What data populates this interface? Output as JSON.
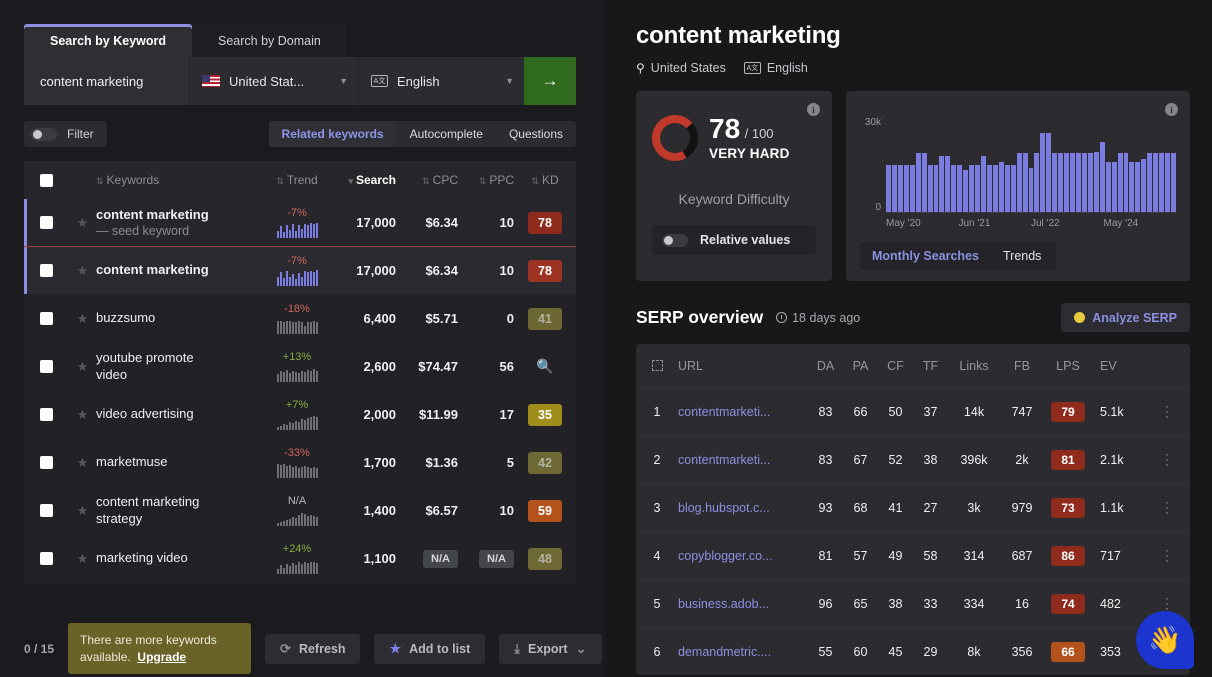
{
  "search_panel": {
    "tabs": [
      {
        "label": "Search by Keyword",
        "active": true
      },
      {
        "label": "Search by Domain",
        "active": false
      }
    ],
    "keyword_value": "content marketing",
    "keyword_placeholder": "Enter keyword",
    "country": "United Stat...",
    "language": "English",
    "go_label": "→",
    "filter_label": "Filter",
    "segments": [
      {
        "label": "Related keywords",
        "active": true
      },
      {
        "label": "Autocomplete",
        "active": false
      },
      {
        "label": "Questions",
        "active": false
      }
    ]
  },
  "keyword_table": {
    "columns": [
      "Keywords",
      "Trend",
      "Search",
      "CPC",
      "PPC",
      "KD"
    ],
    "sorted_by": "Search",
    "rows": [
      {
        "keyword": "content marketing",
        "sub": "— seed keyword",
        "trend": "-7%",
        "trend_dir": "down",
        "search": "17,000",
        "cpc": "$6.34",
        "ppc": "10",
        "kd": "78",
        "kd_color": "#8f2b1d",
        "kd_text": "#ffffff",
        "state": "seed",
        "spark_color": "blue",
        "spark": [
          7,
          12,
          6,
          13,
          8,
          14,
          7,
          13,
          9,
          14,
          13,
          15,
          14,
          15
        ]
      },
      {
        "keyword": "content marketing",
        "sub": "",
        "trend": "-7%",
        "trend_dir": "down",
        "search": "17,000",
        "cpc": "$6.34",
        "ppc": "10",
        "kd": "78",
        "kd_color": "#9c3323",
        "kd_text": "#ffffff",
        "state": "selected",
        "spark_color": "blue",
        "spark": [
          9,
          14,
          8,
          15,
          9,
          12,
          7,
          13,
          9,
          15,
          14,
          15,
          14,
          16
        ]
      },
      {
        "keyword": "buzzsumo",
        "sub": "",
        "trend": "-18%",
        "trend_dir": "down",
        "search": "6,400",
        "cpc": "$5.71",
        "ppc": "0",
        "kd": "41",
        "kd_color": "#6d6733",
        "kd_text": "#b3b0a0",
        "state": "",
        "spark_color": "gray",
        "spark": [
          13,
          13,
          12,
          13,
          13,
          12,
          12,
          13,
          12,
          8,
          12,
          12,
          13,
          12
        ]
      },
      {
        "keyword": "youtube promote",
        "sub2": "video",
        "trend": "+13%",
        "trend_dir": "up",
        "search": "2,600",
        "cpc": "$74.47",
        "ppc": "56",
        "kd": "",
        "kd_icon": "search-icon",
        "kd_color": "",
        "kd_text": "",
        "state": "",
        "spark_color": "gray",
        "spark": [
          8,
          11,
          10,
          12,
          9,
          11,
          10,
          9,
          11,
          10,
          12,
          11,
          13,
          11
        ]
      },
      {
        "keyword": "video advertising",
        "sub": "",
        "trend": "+7%",
        "trend_dir": "up",
        "search": "2,000",
        "cpc": "$11.99",
        "ppc": "17",
        "kd": "35",
        "kd_color": "#a08d1c",
        "kd_text": "#ffffff",
        "state": "",
        "spark_color": "gray",
        "spark": [
          3,
          4,
          6,
          5,
          8,
          7,
          9,
          8,
          11,
          10,
          12,
          13,
          14,
          13
        ]
      },
      {
        "keyword": "marketmuse",
        "sub": "",
        "trend": "-33%",
        "trend_dir": "down",
        "search": "1,700",
        "cpc": "$1.36",
        "ppc": "5",
        "kd": "42",
        "kd_color": "#6e6835",
        "kd_text": "#b4b1a1",
        "state": "",
        "spark_color": "gray",
        "spark": [
          14,
          13,
          14,
          12,
          13,
          11,
          12,
          10,
          11,
          12,
          11,
          10,
          11,
          10
        ]
      },
      {
        "keyword": "content marketing",
        "sub2": "strategy",
        "trend": "N/A",
        "trend_dir": "na",
        "search": "1,400",
        "cpc": "$6.57",
        "ppc": "10",
        "kd": "59",
        "kd_color": "#b4521c",
        "kd_text": "#ffffff",
        "state": "",
        "spark_color": "gray",
        "spark": [
          3,
          4,
          5,
          6,
          7,
          9,
          8,
          11,
          13,
          12,
          10,
          11,
          10,
          9
        ]
      },
      {
        "keyword": "marketing video",
        "sub": "",
        "trend": "+24%",
        "trend_dir": "up",
        "search": "1,100",
        "cpc": "N/A",
        "cpc_na": true,
        "ppc": "N/A",
        "ppc_na": true,
        "kd": "48",
        "kd_color": "#6e6835",
        "kd_text": "#b4b1a1",
        "state": "",
        "spark_color": "gray",
        "spark": [
          5,
          9,
          6,
          10,
          8,
          11,
          9,
          12,
          10,
          12,
          11,
          12,
          12,
          11
        ]
      }
    ]
  },
  "bottom_bar": {
    "counter": "0 / 15",
    "notice_text": "There are more keywords available.",
    "notice_link": "Upgrade",
    "buttons": [
      {
        "label": "Refresh",
        "icon": "refresh-icon"
      },
      {
        "label": "Add to list",
        "icon": "star-icon"
      },
      {
        "label": "Export",
        "icon": "download-icon",
        "caret": "⌄"
      }
    ]
  },
  "overview": {
    "title": "content marketing",
    "country": "United States",
    "language": "English",
    "kd_widget": {
      "value": "78",
      "out_of": "/ 100",
      "level": "VERY HARD",
      "label": "Keyword Difficulty",
      "toggle_label": "Relative values"
    },
    "trend_widget": {
      "tabs": [
        {
          "label": "Monthly Searches",
          "active": true
        },
        {
          "label": "Trends",
          "active": false
        }
      ]
    }
  },
  "chart_data": {
    "type": "bar",
    "title": "Monthly Searches",
    "xlabel": "",
    "ylabel": "",
    "ylim": [
      0,
      30000
    ],
    "ytick_labels": [
      "0",
      "30k"
    ],
    "xtick_labels": [
      "May '20",
      "Jun '21",
      "Jul '22",
      "May '24"
    ],
    "grid": false,
    "legend": "none",
    "bar_color": "#7b7de0",
    "categories": [
      "May '20",
      "Jun '20",
      "Jul '20",
      "Aug '20",
      "Sep '20",
      "Oct '20",
      "Nov '20",
      "Dec '20",
      "Jan '21",
      "Feb '21",
      "Mar '21",
      "Apr '21",
      "May '21",
      "Jun '21",
      "Jul '21",
      "Aug '21",
      "Sep '21",
      "Oct '21",
      "Nov '21",
      "Dec '21",
      "Jan '22",
      "Feb '22",
      "Mar '22",
      "Apr '22",
      "May '22",
      "Jun '22",
      "Jul '22",
      "Aug '22",
      "Sep '22",
      "Oct '22",
      "Nov '22",
      "Dec '22",
      "Jan '23",
      "Feb '23",
      "Mar '23",
      "Apr '23",
      "May '23",
      "Jun '23",
      "Jul '23",
      "Aug '23",
      "Sep '23",
      "Oct '23",
      "Nov '23",
      "Dec '23",
      "Jan '24",
      "Feb '24",
      "Mar '24",
      "Apr '24",
      "May '24"
    ],
    "values": [
      16500,
      16500,
      16500,
      16500,
      16500,
      20500,
      20500,
      16500,
      16500,
      19500,
      19500,
      16500,
      16500,
      14500,
      16500,
      16500,
      19500,
      16500,
      16500,
      17500,
      16500,
      16500,
      20500,
      20500,
      15500,
      20500,
      27500,
      27500,
      20500,
      20500,
      20500,
      20500,
      20500,
      20500,
      20500,
      21000,
      24500,
      17500,
      17500,
      20500,
      20500,
      17500,
      17500,
      18500,
      20500,
      20500,
      20500,
      20500,
      20500
    ]
  },
  "serp": {
    "title": "SERP overview",
    "age": "18 days ago",
    "analyze_label": "Analyze SERP",
    "columns": [
      "URL",
      "DA",
      "PA",
      "CF",
      "TF",
      "Links",
      "FB",
      "LPS",
      "EV"
    ],
    "rows": [
      {
        "pos": "1",
        "url": "contentmarketi...",
        "da": "83",
        "pa": "66",
        "cf": "50",
        "tf": "37",
        "links": "14k",
        "fb": "747",
        "lps": "79",
        "lps_color": "#8f2b1d",
        "ev": "5.1k"
      },
      {
        "pos": "2",
        "url": "contentmarketi...",
        "da": "83",
        "pa": "67",
        "cf": "52",
        "tf": "38",
        "links": "396k",
        "fb": "2k",
        "lps": "81",
        "lps_color": "#8f2b1d",
        "ev": "2.1k"
      },
      {
        "pos": "3",
        "url": "blog.hubspot.c...",
        "da": "93",
        "pa": "68",
        "cf": "41",
        "tf": "27",
        "links": "3k",
        "fb": "979",
        "lps": "73",
        "lps_color": "#8f2b1d",
        "ev": "1.1k"
      },
      {
        "pos": "4",
        "url": "copyblogger.co...",
        "da": "81",
        "pa": "57",
        "cf": "49",
        "tf": "58",
        "links": "314",
        "fb": "687",
        "lps": "86",
        "lps_color": "#8f2b1d",
        "ev": "717"
      },
      {
        "pos": "5",
        "url": "business.adob...",
        "da": "96",
        "pa": "65",
        "cf": "38",
        "tf": "33",
        "links": "334",
        "fb": "16",
        "lps": "74",
        "lps_color": "#8f2b1d",
        "ev": "482"
      },
      {
        "pos": "6",
        "url": "demandmetric....",
        "da": "55",
        "pa": "60",
        "cf": "45",
        "tf": "29",
        "links": "8k",
        "fb": "356",
        "lps": "66",
        "lps_color": "#b4521c",
        "ev": "353"
      }
    ]
  },
  "help_button": {
    "icon": "waving-hand-icon",
    "glyph": "👋"
  }
}
